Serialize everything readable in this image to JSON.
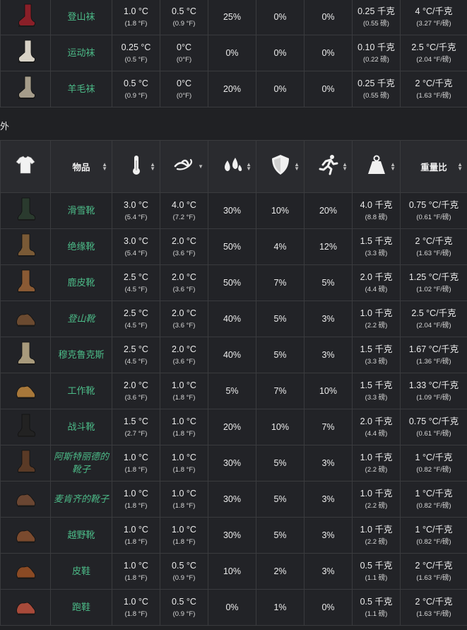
{
  "top_rows": [
    {
      "name": "登山袜",
      "italic": false,
      "shoe": "sock",
      "color": "#8a1f28",
      "warmth": "1.0 °C",
      "warmth_f": "(1.8 °F)",
      "wind": "0.5 °C",
      "wind_f": "(0.9 °F)",
      "water": "25%",
      "protection": "0%",
      "mobility": "0%",
      "weight": "0.25 千克",
      "weight_lb": "(0.55 磅)",
      "ratio": "4 °C/千克",
      "ratio_f": "(3.27 °F/磅)"
    },
    {
      "name": "运动袜",
      "italic": false,
      "shoe": "sock",
      "color": "#d8d2c6",
      "warmth": "0.25 °C",
      "warmth_f": "(0.5 °F)",
      "wind": "0°C",
      "wind_f": "(0°F)",
      "water": "0%",
      "protection": "0%",
      "mobility": "0%",
      "weight": "0.10 千克",
      "weight_lb": "(0.22 磅)",
      "ratio": "2.5 °C/千克",
      "ratio_f": "(2.04 °F/磅)"
    },
    {
      "name": "羊毛袜",
      "italic": false,
      "shoe": "sock",
      "color": "#a59c8a",
      "warmth": "0.5 °C",
      "warmth_f": "(0.9 °F)",
      "wind": "0°C",
      "wind_f": "(0°F)",
      "water": "20%",
      "protection": "0%",
      "mobility": "0%",
      "weight": "0.25 千克",
      "weight_lb": "(0.55 磅)",
      "ratio": "2 °C/千克",
      "ratio_f": "(1.63 °F/磅)"
    }
  ],
  "section_label": "外",
  "header": {
    "icon_item": "shirt-icon",
    "item_label": "物品",
    "icon_warmth": "thermometer-icon",
    "icon_wind": "wind-icon",
    "icon_water": "water-drops-icon",
    "icon_protection": "shield-icon",
    "icon_mobility": "runner-icon",
    "icon_weight": "weight-icon",
    "ratio_label": "重量比"
  },
  "rows": [
    {
      "name": "滑雪靴",
      "italic": false,
      "shoe": "boot",
      "color": "#2a3a2e",
      "warmth": "3.0 °C",
      "warmth_f": "(5.4 °F)",
      "wind": "4.0 °C",
      "wind_f": "(7.2 °F)",
      "water": "30%",
      "protection": "10%",
      "mobility": "20%",
      "weight": "4.0 千克",
      "weight_lb": "(8.8 磅)",
      "ratio": "0.75 °C/千克",
      "ratio_f": "(0.61 °F/磅)"
    },
    {
      "name": "绝缘靴",
      "italic": false,
      "shoe": "boot",
      "color": "#7a5a36",
      "warmth": "3.0 °C",
      "warmth_f": "(5.4 °F)",
      "wind": "2.0 °C",
      "wind_f": "(3.6 °F)",
      "water": "50%",
      "protection": "4%",
      "mobility": "12%",
      "weight": "1.5 千克",
      "weight_lb": "(3.3 磅)",
      "ratio": "2 °C/千克",
      "ratio_f": "(1.63 °F/磅)"
    },
    {
      "name": "鹿皮靴",
      "italic": false,
      "shoe": "boot",
      "color": "#8a5a34",
      "warmth": "2.5 °C",
      "warmth_f": "(4.5 °F)",
      "wind": "2.0 °C",
      "wind_f": "(3.6 °F)",
      "water": "50%",
      "protection": "7%",
      "mobility": "5%",
      "weight": "2.0 千克",
      "weight_lb": "(4.4 磅)",
      "ratio": "1.25 °C/千克",
      "ratio_f": "(1.02 °F/磅)"
    },
    {
      "name": "登山靴",
      "italic": true,
      "shoe": "shoe",
      "color": "#6b4a30",
      "warmth": "2.5 °C",
      "warmth_f": "(4.5 °F)",
      "wind": "2.0 °C",
      "wind_f": "(3.6 °F)",
      "water": "40%",
      "protection": "5%",
      "mobility": "3%",
      "weight": "1.0 千克",
      "weight_lb": "(2.2 磅)",
      "ratio": "2.5 °C/千克",
      "ratio_f": "(2.04 °F/磅)"
    },
    {
      "name": "穆克鲁克斯",
      "italic": false,
      "shoe": "boot",
      "color": "#a89a7c",
      "warmth": "2.5 °C",
      "warmth_f": "(4.5 °F)",
      "wind": "2.0 °C",
      "wind_f": "(3.6 °F)",
      "water": "40%",
      "protection": "5%",
      "mobility": "3%",
      "weight": "1.5 千克",
      "weight_lb": "(3.3 磅)",
      "ratio": "1.67 °C/千克",
      "ratio_f": "(1.36 °F/磅)"
    },
    {
      "name": "工作靴",
      "italic": false,
      "shoe": "shoe",
      "color": "#a8783a",
      "warmth": "2.0 °C",
      "warmth_f": "(3.6 °F)",
      "wind": "1.0 °C",
      "wind_f": "(1.8 °F)",
      "water": "5%",
      "protection": "7%",
      "mobility": "10%",
      "weight": "1.5 千克",
      "weight_lb": "(3.3 磅)",
      "ratio": "1.33 °C/千克",
      "ratio_f": "(1.09 °F/磅)"
    },
    {
      "name": "战斗靴",
      "italic": false,
      "shoe": "boot",
      "color": "#222222",
      "warmth": "1.5 °C",
      "warmth_f": "(2.7 °F)",
      "wind": "1.0 °C",
      "wind_f": "(1.8 °F)",
      "water": "20%",
      "protection": "10%",
      "mobility": "7%",
      "weight": "2.0 千克",
      "weight_lb": "(4.4 磅)",
      "ratio": "0.75 °C/千克",
      "ratio_f": "(0.61 °F/磅)"
    },
    {
      "name": "阿斯特丽德的\n靴子",
      "italic": true,
      "shoe": "boot",
      "color": "#5a3a26",
      "warmth": "1.0 °C",
      "warmth_f": "(1.8 °F)",
      "wind": "1.0 °C",
      "wind_f": "(1.8 °F)",
      "water": "30%",
      "protection": "5%",
      "mobility": "3%",
      "weight": "1.0 千克",
      "weight_lb": "(2.2 磅)",
      "ratio": "1 °C/千克",
      "ratio_f": "(0.82 °F/磅)"
    },
    {
      "name": "麦肯齐的靴子",
      "italic": true,
      "shoe": "shoe",
      "color": "#6a4632",
      "warmth": "1.0 °C",
      "warmth_f": "(1.8 °F)",
      "wind": "1.0 °C",
      "wind_f": "(1.8 °F)",
      "water": "30%",
      "protection": "5%",
      "mobility": "3%",
      "weight": "1.0 千克",
      "weight_lb": "(2.2 磅)",
      "ratio": "1 °C/千克",
      "ratio_f": "(0.82 °F/磅)"
    },
    {
      "name": "越野靴",
      "italic": false,
      "shoe": "shoe",
      "color": "#7a4a2e",
      "warmth": "1.0 °C",
      "warmth_f": "(1.8 °F)",
      "wind": "1.0 °C",
      "wind_f": "(1.8 °F)",
      "water": "30%",
      "protection": "5%",
      "mobility": "3%",
      "weight": "1.0 千克",
      "weight_lb": "(2.2 磅)",
      "ratio": "1 °C/千克",
      "ratio_f": "(0.82 °F/磅)"
    },
    {
      "name": "皮鞋",
      "italic": false,
      "shoe": "shoe",
      "color": "#8a4a24",
      "warmth": "1.0 °C",
      "warmth_f": "(1.8 °F)",
      "wind": "0.5 °C",
      "wind_f": "(0.9 °F)",
      "water": "10%",
      "protection": "2%",
      "mobility": "3%",
      "weight": "0.5 千克",
      "weight_lb": "(1.1 磅)",
      "ratio": "2 °C/千克",
      "ratio_f": "(1.63 °F/磅)"
    },
    {
      "name": "跑鞋",
      "italic": false,
      "shoe": "shoe",
      "color": "#a84a3a",
      "warmth": "1.0 °C",
      "warmth_f": "(1.8 °F)",
      "wind": "0.5 °C",
      "wind_f": "(0.9 °F)",
      "water": "0%",
      "protection": "1%",
      "mobility": "0%",
      "weight": "0.5 千克",
      "weight_lb": "(1.1 磅)",
      "ratio": "2 °C/千克",
      "ratio_f": "(1.63 °F/磅)"
    }
  ]
}
